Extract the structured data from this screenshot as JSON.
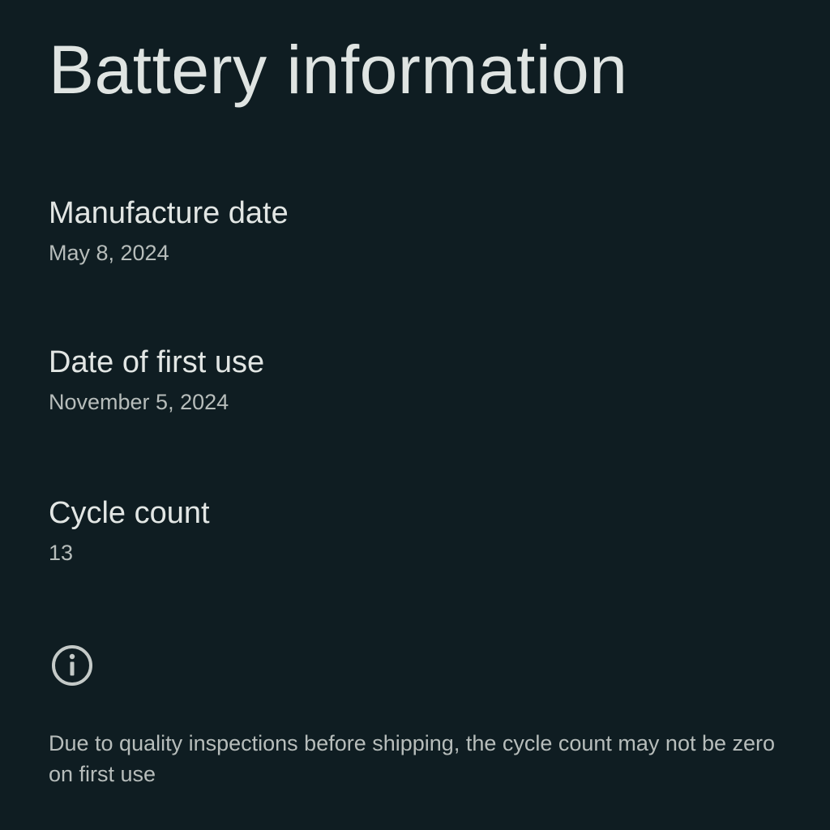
{
  "header": {
    "title": "Battery information"
  },
  "items": [
    {
      "title": "Manufacture date",
      "summary": "May 8, 2024"
    },
    {
      "title": "Date of first use",
      "summary": "November 5, 2024"
    },
    {
      "title": "Cycle count",
      "summary": "13"
    }
  ],
  "footer": {
    "icon": "info-icon",
    "text": "Due to quality inspections before shipping, the cycle count may not be zero on first use"
  },
  "colors": {
    "background": "#0f1d22",
    "primary_text": "#e1e4e3",
    "secondary_text": "#b7bdbb",
    "icon": "#c4cac8"
  }
}
